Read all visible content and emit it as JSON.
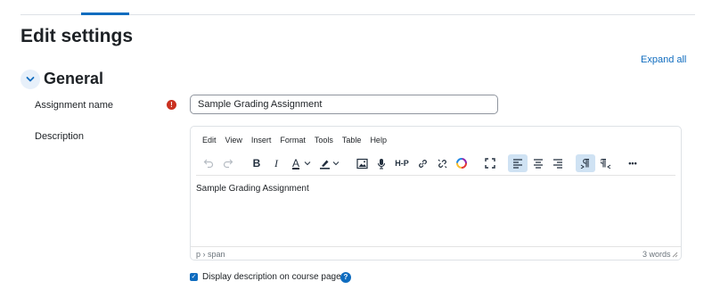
{
  "page": {
    "title": "Edit settings",
    "expand_all": "Expand all"
  },
  "section": {
    "title": "General"
  },
  "fields": {
    "assignment_name_label": "Assignment name",
    "assignment_name_value": "Sample Grading Assignment",
    "required_marker": "!",
    "description_label": "Description"
  },
  "editor": {
    "menu": [
      "Edit",
      "View",
      "Insert",
      "Format",
      "Tools",
      "Table",
      "Help"
    ],
    "toolbar": {
      "undo": "undo-icon",
      "redo": "redo-icon",
      "bold": "B",
      "italic": "I",
      "text_color": "A",
      "h5p": "H-P",
      "more": "•••",
      "active_color": "#cfe2f3"
    },
    "content": "Sample Grading Assignment",
    "status_path": "p › span",
    "word_count": "3 words"
  },
  "display_checkbox": {
    "label": "Display description on course page",
    "checked": true,
    "help": "?"
  },
  "colors": {
    "accent": "#0f6cbf",
    "required": "#ca3120",
    "text": "#1d2125"
  }
}
